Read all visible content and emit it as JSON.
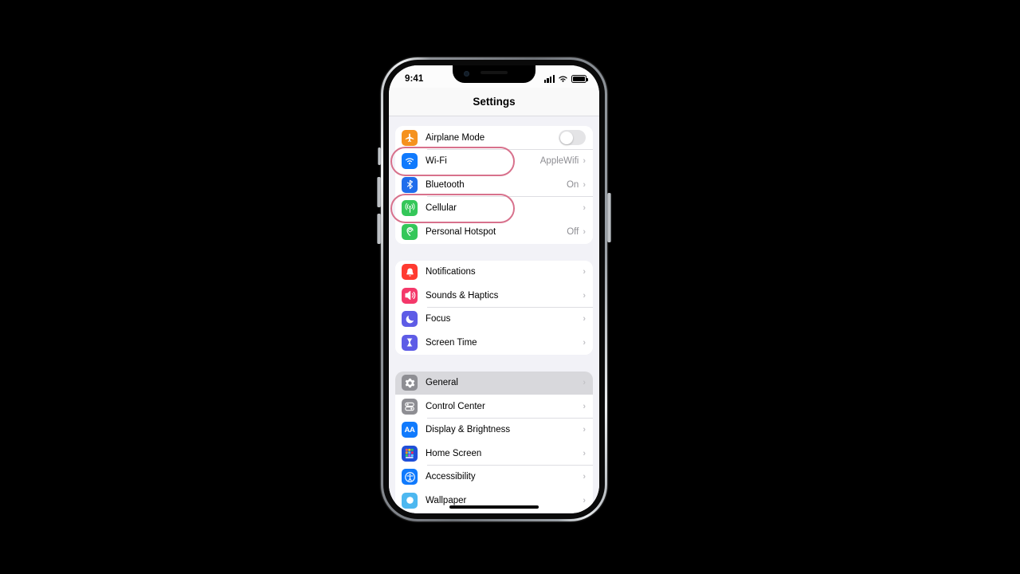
{
  "device": {
    "name": "iphone-13",
    "frame_color": "#8d9197"
  },
  "status_bar": {
    "time": "9:41",
    "signal_icon": "cellular-bars-icon",
    "wifi_icon": "wifi-icon",
    "battery_icon": "battery-full-icon"
  },
  "nav": {
    "title": "Settings"
  },
  "annotations": {
    "color": "#d8718c",
    "targets": [
      "Wi-Fi",
      "Cellular"
    ]
  },
  "groups": [
    {
      "id": "connectivity",
      "rows": [
        {
          "label": "Airplane Mode",
          "icon": "airplane-icon",
          "icon_bg": "#f5921e",
          "control": "toggle",
          "toggle_on": false,
          "value": "",
          "chevron": false,
          "highlighted": false
        },
        {
          "label": "Wi-Fi",
          "icon": "wifi-icon",
          "icon_bg": "#107afd",
          "control": "value",
          "value": "AppleWifi",
          "chevron": true,
          "highlighted": false,
          "annotated": true
        },
        {
          "label": "Bluetooth",
          "icon": "bluetooth-icon",
          "icon_bg": "#1f6dec",
          "control": "value",
          "value": "On",
          "chevron": true,
          "highlighted": false
        },
        {
          "label": "Cellular",
          "icon": "cellular-antenna-icon",
          "icon_bg": "#34c759",
          "control": "value",
          "value": "",
          "chevron": true,
          "highlighted": false,
          "annotated": true
        },
        {
          "label": "Personal Hotspot",
          "icon": "hotspot-icon",
          "icon_bg": "#34c759",
          "control": "value",
          "value": "Off",
          "chevron": true,
          "highlighted": false
        }
      ]
    },
    {
      "id": "alerts",
      "rows": [
        {
          "label": "Notifications",
          "icon": "bell-icon",
          "icon_bg": "#ff3b30",
          "control": "value",
          "value": "",
          "chevron": true,
          "highlighted": false
        },
        {
          "label": "Sounds & Haptics",
          "icon": "speaker-icon",
          "icon_bg": "#f4386a",
          "control": "value",
          "value": "",
          "chevron": true,
          "highlighted": false
        },
        {
          "label": "Focus",
          "icon": "moon-icon",
          "icon_bg": "#5e5ce6",
          "control": "value",
          "value": "",
          "chevron": true,
          "highlighted": false
        },
        {
          "label": "Screen Time",
          "icon": "hourglass-icon",
          "icon_bg": "#5e5ce6",
          "control": "value",
          "value": "",
          "chevron": true,
          "highlighted": false
        }
      ]
    },
    {
      "id": "system",
      "rows": [
        {
          "label": "General",
          "icon": "gear-icon",
          "icon_bg": "#8e8e93",
          "control": "value",
          "value": "",
          "chevron": true,
          "highlighted": true
        },
        {
          "label": "Control Center",
          "icon": "sliders-icon",
          "icon_bg": "#8e8e93",
          "control": "value",
          "value": "",
          "chevron": true,
          "highlighted": false
        },
        {
          "label": "Display & Brightness",
          "icon": "text-size-icon",
          "icon_bg": "#107afd",
          "control": "value",
          "value": "",
          "chevron": true,
          "highlighted": false
        },
        {
          "label": "Home Screen",
          "icon": "app-grid-icon",
          "icon_bg": "#1f4fd8",
          "control": "value",
          "value": "",
          "chevron": true,
          "highlighted": false
        },
        {
          "label": "Accessibility",
          "icon": "accessibility-icon",
          "icon_bg": "#107afd",
          "control": "value",
          "value": "",
          "chevron": true,
          "highlighted": false
        },
        {
          "label": "Wallpaper",
          "icon": "wallpaper-icon",
          "icon_bg": "#4db8f0",
          "control": "value",
          "value": "",
          "chevron": true,
          "highlighted": false
        }
      ]
    }
  ]
}
